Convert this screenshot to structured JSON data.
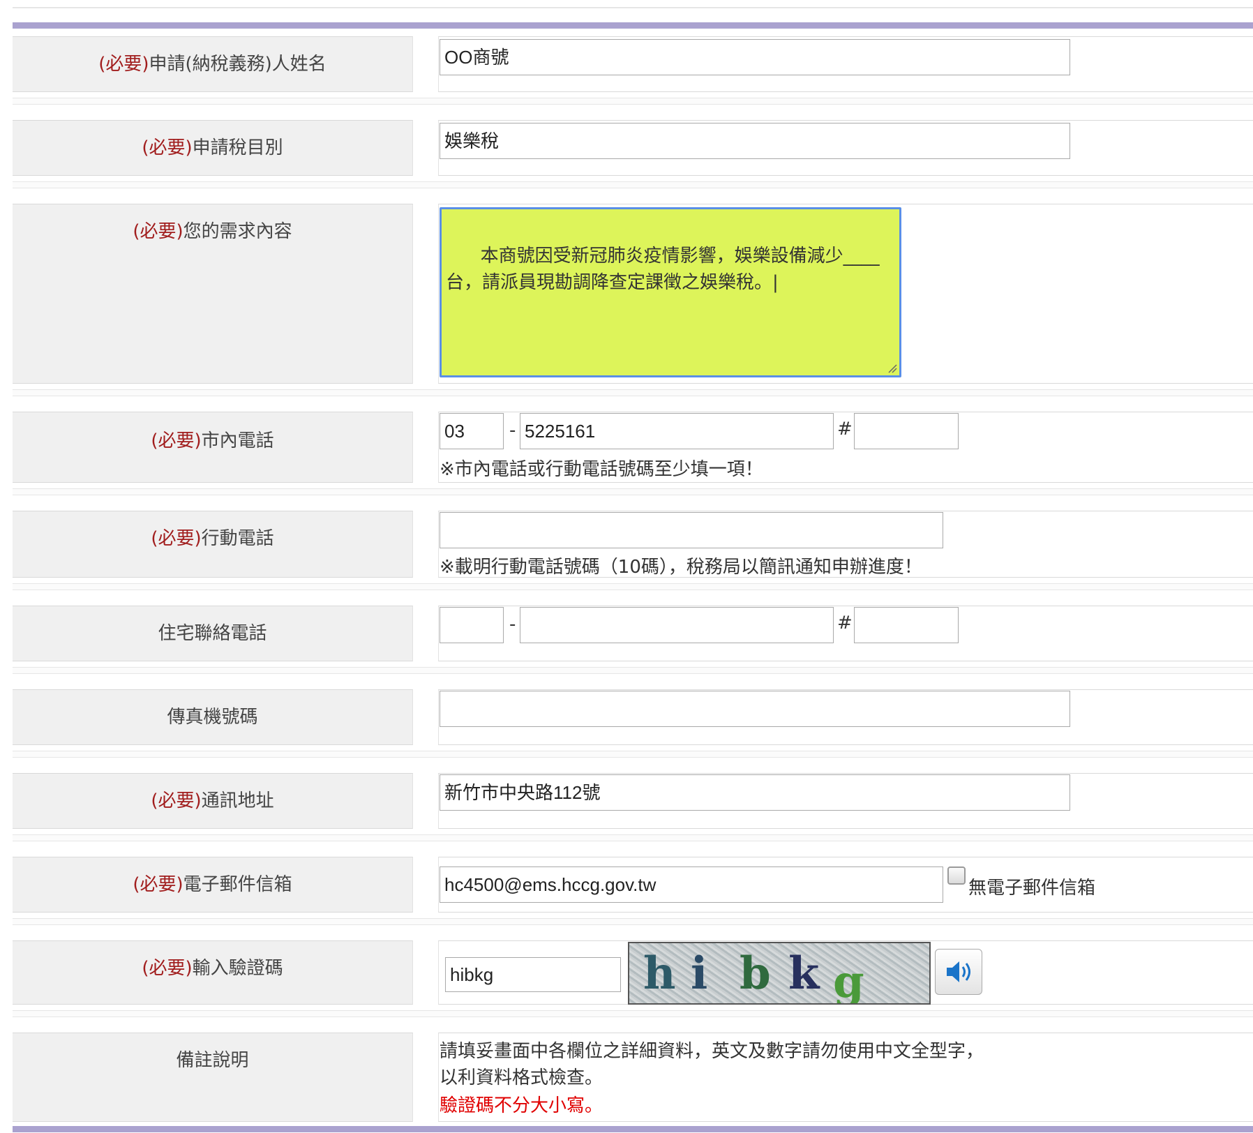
{
  "required_tag": "(必要)",
  "rows": {
    "applicant_name": {
      "label": "申請(納稅義務)人姓名",
      "value": "OO商號"
    },
    "tax_item": {
      "label": "申請稅目別",
      "value": "娛樂稅"
    },
    "request": {
      "label": "您的需求內容",
      "value": "本商號因受新冠肺炎疫情影響，娛樂設備減少____\n台，請派員現勘調降查定課徵之娛樂稅。|"
    },
    "local_phone": {
      "label": "市內電話",
      "area": "03",
      "dash": "-",
      "number": "5225161",
      "hash": "#",
      "ext": "",
      "note": "※市內電話或行動電話號碼至少填一項！"
    },
    "mobile": {
      "label": "行動電話",
      "value": "",
      "note": "※載明行動電話號碼（10碼），稅務局以簡訊通知申辦進度！"
    },
    "home_phone": {
      "label": "住宅聯絡電話",
      "area": "",
      "dash": "-",
      "number": "",
      "hash": "#",
      "ext": ""
    },
    "fax": {
      "label": "傳真機號碼",
      "value": ""
    },
    "address": {
      "label": "通訊地址",
      "value": "新竹市中央路112號"
    },
    "email": {
      "label": "電子郵件信箱",
      "value": "hc4500@ems.hccg.gov.tw",
      "no_email_label": "無電子郵件信箱",
      "no_email_checked": false
    },
    "captcha": {
      "label": "輸入驗證碼",
      "value": "hibkg",
      "image_chars": [
        "h",
        "i",
        "b",
        "k",
        "g"
      ]
    },
    "remarks": {
      "label": "備註說明",
      "line1": "請填妥畫面中各欄位之詳細資料，英文及數字請勿使用中文全型字，",
      "line2": "以利資料格式檢查。",
      "line3": "驗證碼不分大小寫。"
    }
  },
  "colors": {
    "header_bar": "#aaa2cf",
    "required": "#a11d1d",
    "textarea_bg": "#ddf45a",
    "textarea_border": "#5a8fe6",
    "warning": "#e00000"
  }
}
